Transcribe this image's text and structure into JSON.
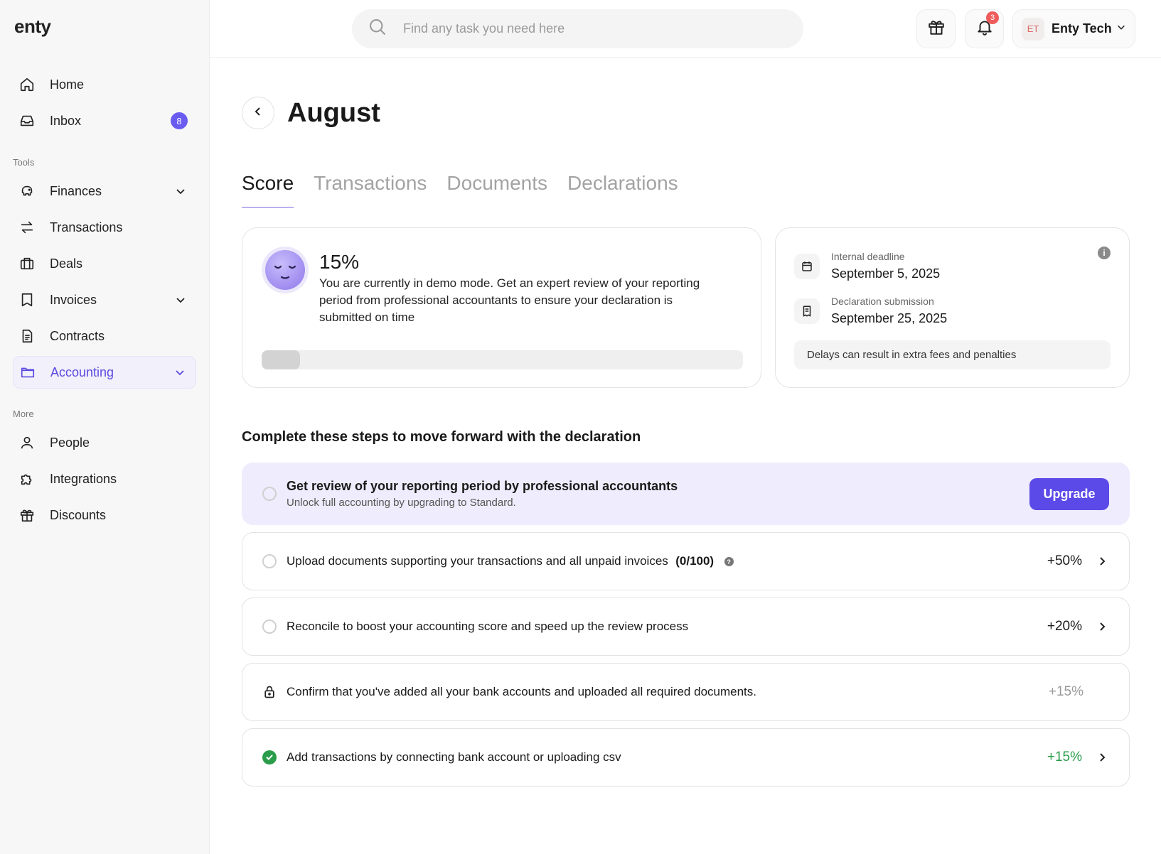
{
  "app": {
    "logo": "enty"
  },
  "sidebar": {
    "items": [
      {
        "label": "Home",
        "icon": "home-icon"
      },
      {
        "label": "Inbox",
        "icon": "inbox-icon",
        "badge": "8"
      }
    ],
    "tools_label": "Tools",
    "tools": [
      {
        "label": "Finances",
        "icon": "finances-icon",
        "has_chevron": true
      },
      {
        "label": "Transactions",
        "icon": "transfer-icon"
      },
      {
        "label": "Deals",
        "icon": "briefcase-icon"
      },
      {
        "label": "Invoices",
        "icon": "invoice-icon",
        "has_chevron": true
      },
      {
        "label": "Contracts",
        "icon": "document-icon"
      },
      {
        "label": "Accounting",
        "icon": "folder-icon",
        "has_chevron": true,
        "active": true
      }
    ],
    "more_label": "More",
    "more": [
      {
        "label": "People",
        "icon": "person-icon"
      },
      {
        "label": "Integrations",
        "icon": "puzzle-icon"
      },
      {
        "label": "Discounts",
        "icon": "gift-icon"
      }
    ]
  },
  "topbar": {
    "search_placeholder": "Find any task you need here",
    "notification_count": "3",
    "user_initials": "ET",
    "user_name": "Enty Tech"
  },
  "page": {
    "title": "August",
    "tabs": [
      {
        "label": "Score",
        "active": true
      },
      {
        "label": "Transactions"
      },
      {
        "label": "Documents"
      },
      {
        "label": "Declarations"
      }
    ]
  },
  "score": {
    "percent": "15%",
    "progress_fraction": 0.08,
    "message": "You are currently in demo mode. Get an expert review of your reporting period from professional accountants to ensure your declaration is submitted on time"
  },
  "deadlines": {
    "internal_label": "Internal deadline",
    "internal_date": "September 5, 2025",
    "submission_label": "Declaration submission",
    "submission_date": "September 25, 2025",
    "warning": "Delays can result in extra fees and penalties"
  },
  "steps": {
    "title": "Complete these steps to move forward with the declaration",
    "upgrade": {
      "title": "Get review of your reporting period by professional accountants",
      "subtitle": "Unlock full accounting by upgrading to Standard.",
      "button": "Upgrade"
    },
    "items": [
      {
        "text": "Upload documents supporting your transactions and all unpaid invoices",
        "count": "(0/100)",
        "percent": "+50%",
        "state": "pending"
      },
      {
        "text": "Reconcile to boost your accounting score and speed up the review process",
        "percent": "+20%",
        "state": "pending"
      },
      {
        "text": "Confirm that you've added all your bank accounts and uploaded all required documents.",
        "percent": "+15%",
        "state": "locked"
      },
      {
        "text": "Add transactions by connecting bank account or uploading csv",
        "percent": "+15%",
        "state": "done"
      }
    ]
  },
  "colors": {
    "accent": "#5b4ae8",
    "accent_bg": "#efecfd",
    "success": "#2a9d4a",
    "badge": "#6a5cf0",
    "notification": "#ef5b5b"
  }
}
